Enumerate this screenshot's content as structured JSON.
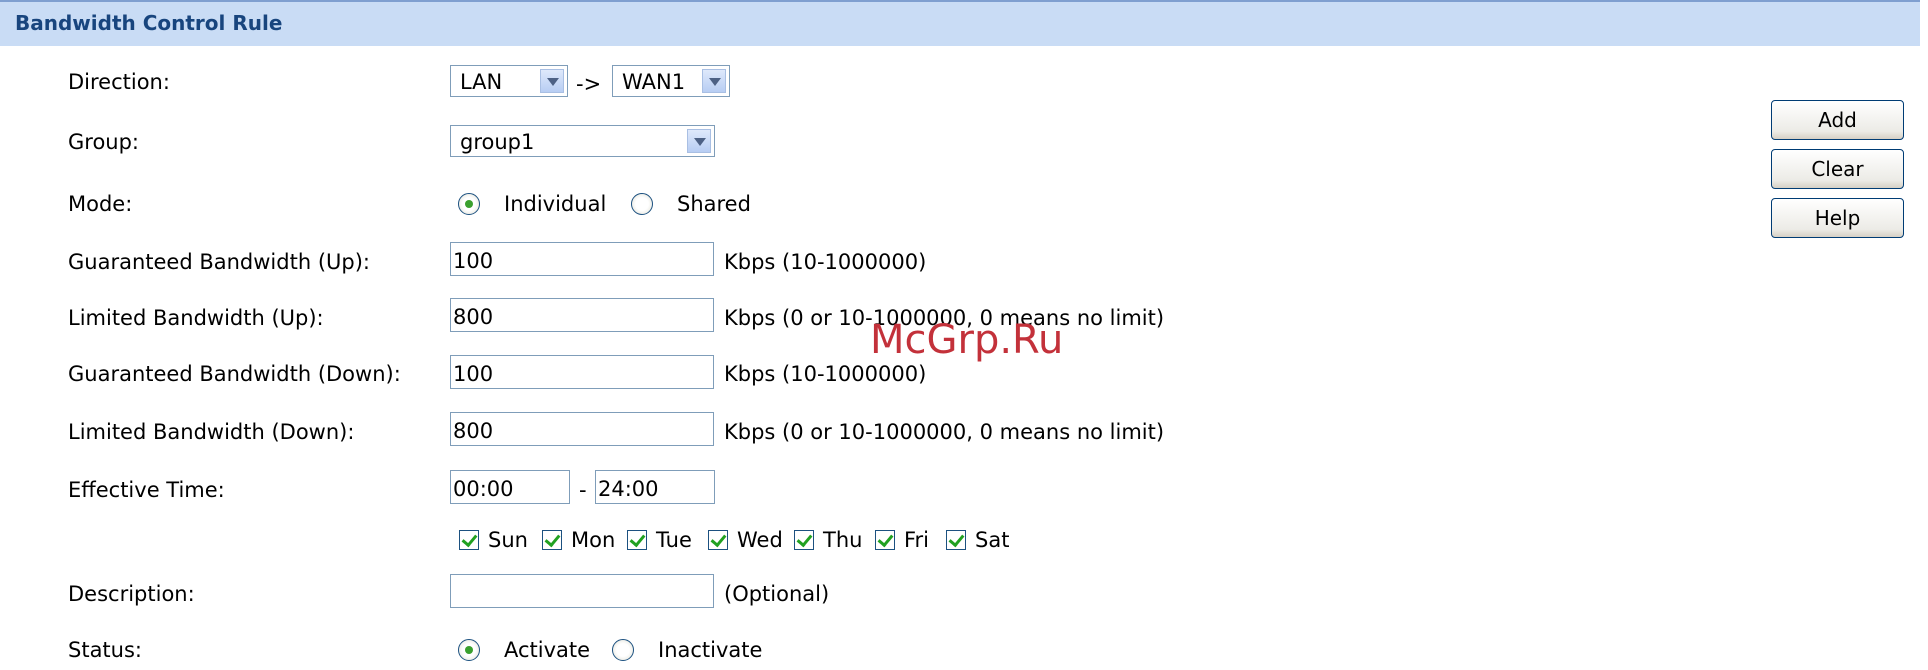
{
  "header": {
    "title": "Bandwidth Control Rule"
  },
  "form": {
    "direction": {
      "label": "Direction:",
      "from": "LAN",
      "arrow": "->",
      "to": "WAN1"
    },
    "group": {
      "label": "Group:",
      "value": "group1"
    },
    "mode": {
      "label": "Mode:",
      "options": [
        "Individual",
        "Shared"
      ],
      "selected": "Individual"
    },
    "guaranteed_up": {
      "label": "Guaranteed Bandwidth (Up):",
      "value": "100",
      "hint": "Kbps (10-1000000)"
    },
    "limited_up": {
      "label": "Limited Bandwidth (Up):",
      "value": "800",
      "hint": "Kbps (0 or 10-1000000, 0 means no limit)"
    },
    "guaranteed_down": {
      "label": "Guaranteed Bandwidth (Down):",
      "value": "100",
      "hint": "Kbps (10-1000000)"
    },
    "limited_down": {
      "label": "Limited Bandwidth (Down):",
      "value": "800",
      "hint": "Kbps (0 or 10-1000000, 0 means no limit)"
    },
    "effective_time": {
      "label": "Effective Time:",
      "start": "00:00",
      "separator": "-",
      "end": "24:00"
    },
    "days": [
      {
        "label": "Sun",
        "checked": true
      },
      {
        "label": "Mon",
        "checked": true
      },
      {
        "label": "Tue",
        "checked": true
      },
      {
        "label": "Wed",
        "checked": true
      },
      {
        "label": "Thu",
        "checked": true
      },
      {
        "label": "Fri",
        "checked": true
      },
      {
        "label": "Sat",
        "checked": true
      }
    ],
    "description": {
      "label": "Description:",
      "value": "",
      "hint": "(Optional)"
    },
    "status": {
      "label": "Status:",
      "options": [
        "Activate",
        "Inactivate"
      ],
      "selected": "Activate"
    }
  },
  "buttons": {
    "add": "Add",
    "clear": "Clear",
    "help": "Help"
  },
  "watermark": "McGrp.Ru",
  "colors": {
    "header_bg": "#c9dcf5",
    "header_text": "#18457e",
    "check_green": "#21a121",
    "watermark": "#c3313a"
  },
  "icons": {
    "dropdown": "chevron-down-icon",
    "radio": "radio-button",
    "checkbox": "checkbox-checked"
  }
}
